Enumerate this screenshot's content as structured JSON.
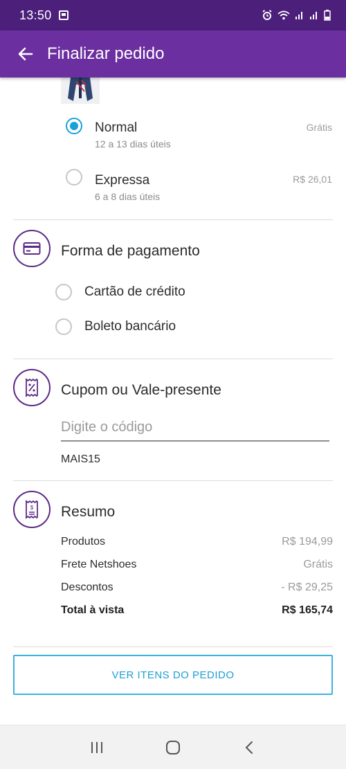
{
  "status_bar": {
    "time": "13:50"
  },
  "app_bar": {
    "title": "Finalizar pedido"
  },
  "shipping": {
    "options": [
      {
        "name": "Normal",
        "eta": "12 a 13 dias úteis",
        "price": "Grátis",
        "selected": true
      },
      {
        "name": "Expressa",
        "eta": "6 a 8 dias úteis",
        "price": "R$ 26,01",
        "selected": false
      }
    ]
  },
  "payment": {
    "title": "Forma de pagamento",
    "options": [
      {
        "label": "Cartão de crédito",
        "selected": false
      },
      {
        "label": "Boleto bancário",
        "selected": false
      }
    ]
  },
  "coupon": {
    "title": "Cupom ou Vale-presente",
    "placeholder": "Digite o código",
    "applied_code": "MAIS15"
  },
  "summary": {
    "title": "Resumo",
    "rows": [
      {
        "label": "Produtos",
        "value": "R$ 194,99"
      },
      {
        "label": "Frete Netshoes",
        "value": "Grátis"
      },
      {
        "label": "Descontos",
        "value": "- R$ 29,25"
      }
    ],
    "total": {
      "label": "Total à vista",
      "value": "R$ 165,74"
    }
  },
  "actions": {
    "view_items_label": "VER ITENS DO PEDIDO"
  },
  "icons": {
    "back": "arrow-left-icon",
    "payment": "credit-card-icon",
    "coupon": "coupon-percent-icon",
    "summary": "receipt-icon"
  },
  "colors": {
    "status_bar": "#4b1f7a",
    "app_bar": "#6b2fa0",
    "accent_blue": "#1aa0d8",
    "icon_purple": "#5b2a86"
  }
}
